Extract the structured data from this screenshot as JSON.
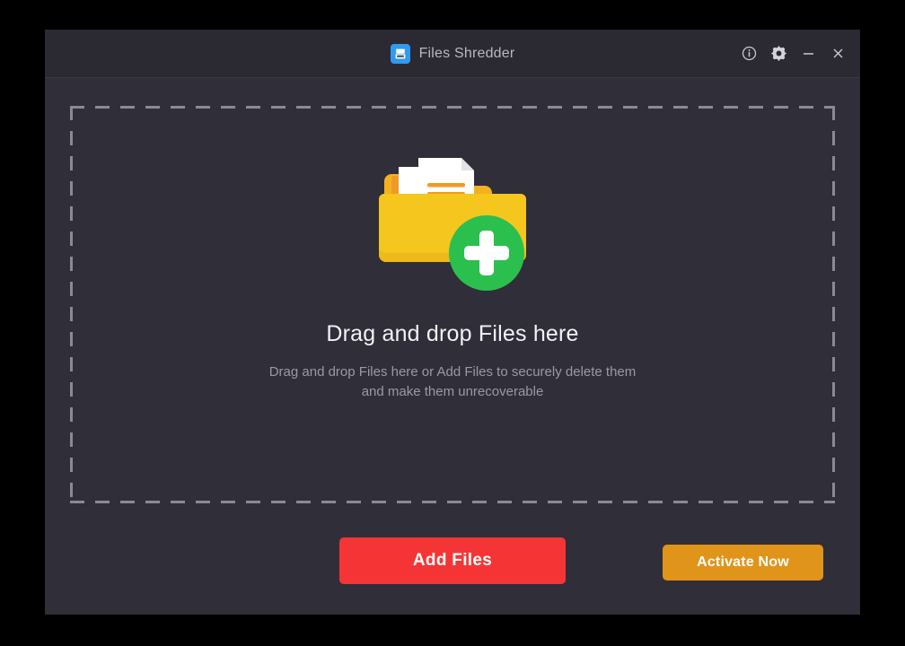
{
  "window": {
    "title": "Files Shredder",
    "logo_icon": "save-floppy-icon"
  },
  "titlebar": {
    "controls": [
      {
        "name": "info-icon",
        "label": "Info"
      },
      {
        "name": "gear-icon",
        "label": "Settings"
      },
      {
        "name": "minimize-icon",
        "label": "Minimize"
      },
      {
        "name": "close-icon",
        "label": "Close"
      }
    ]
  },
  "dropzone": {
    "illustration_icon": "folder-add-files-icon",
    "heading": "Drag and drop Files here",
    "subtext": "Drag and drop Files here or Add Files to securely delete them and make them unrecoverable"
  },
  "side_badge": {
    "icon": "desktop-computer-icon"
  },
  "actions": {
    "add_files_label": "Add Files",
    "activate_label": "Activate Now"
  },
  "colors": {
    "window_bg": "#302E39",
    "titlebar_bg": "#2B2932",
    "dash_border": "#8A8A94",
    "heading_text": "#F2F2F5",
    "sub_text": "#989AA4",
    "add_files_btn": "#F53535",
    "activate_btn": "#E0941A",
    "folder_yellow": "#F5C61E",
    "plus_green": "#2BBF4E",
    "logo_blue": "#2E9BF0"
  }
}
